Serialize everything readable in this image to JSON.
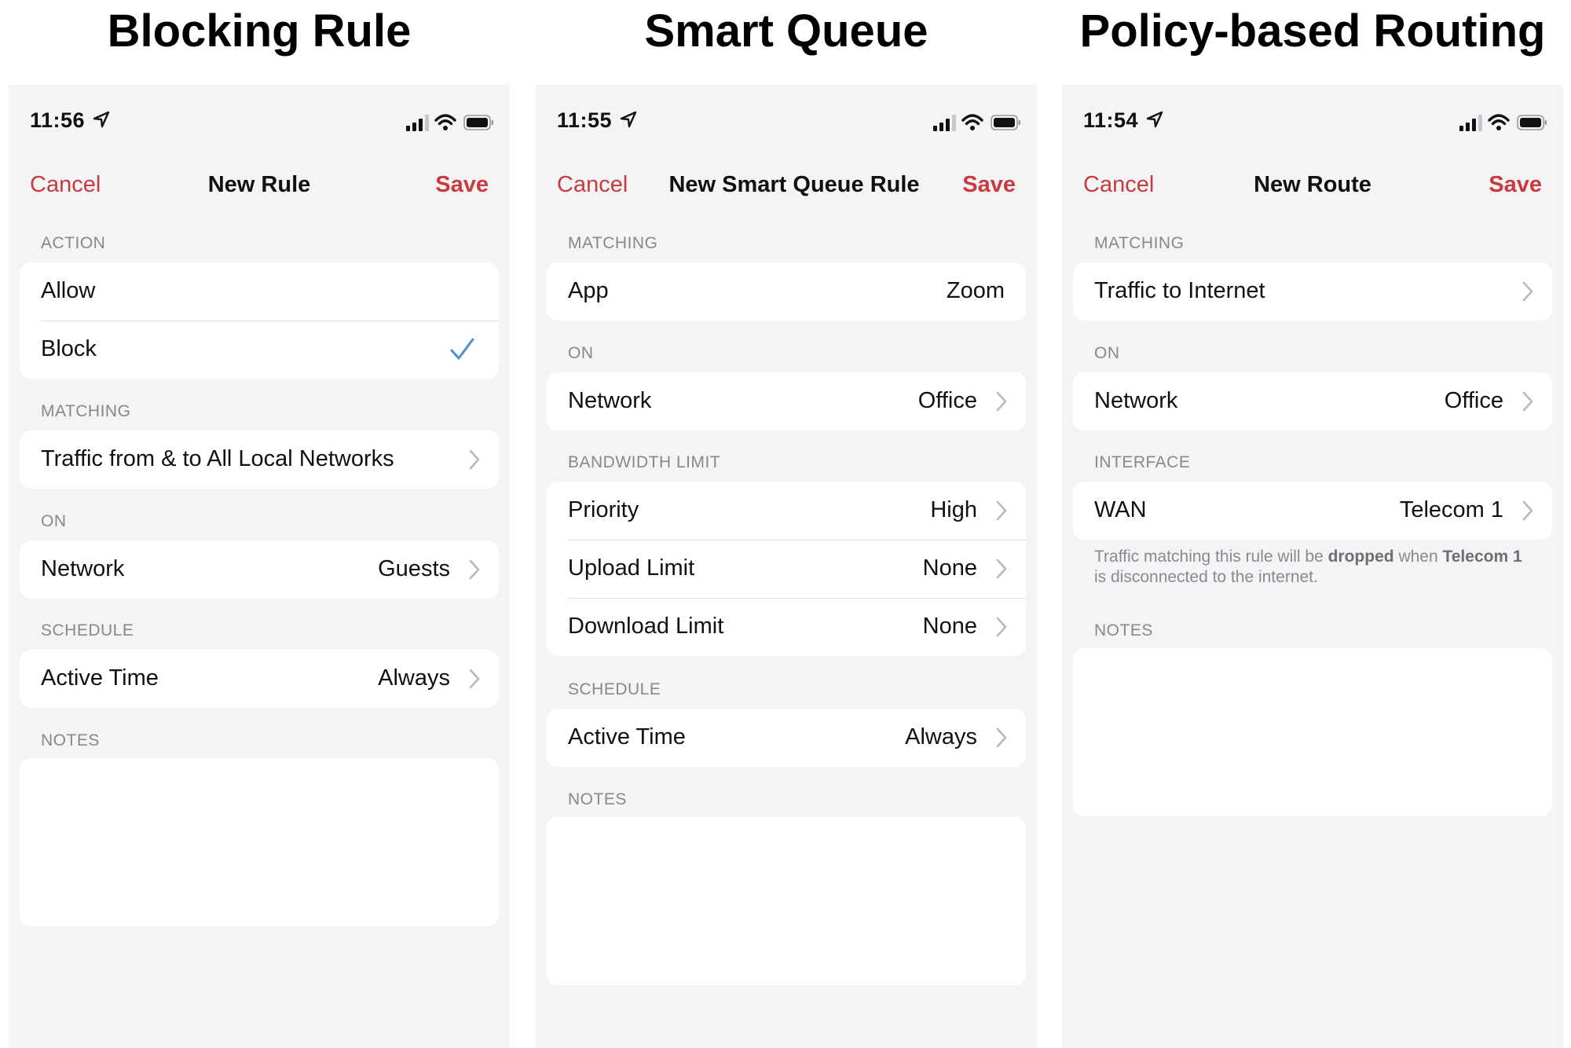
{
  "panels": [
    {
      "heading": "Blocking Rule",
      "status_time": "11:56",
      "nav": {
        "cancel": "Cancel",
        "title": "New Rule",
        "save": "Save"
      },
      "action_header": "ACTION",
      "action_options": [
        "Allow",
        "Block"
      ],
      "action_selected": "Block",
      "matching_header": "MATCHING",
      "matching_value": "Traffic from & to All Local Networks",
      "on_header": "ON",
      "network_label": "Network",
      "network_value": "Guests",
      "schedule_header": "SCHEDULE",
      "active_time_label": "Active Time",
      "active_time_value": "Always",
      "notes_header": "NOTES"
    },
    {
      "heading": "Smart Queue",
      "status_time": "11:55",
      "nav": {
        "cancel": "Cancel",
        "title": "New Smart Queue Rule",
        "save": "Save"
      },
      "matching_header": "MATCHING",
      "app_label": "App",
      "app_value": "Zoom",
      "on_header": "ON",
      "network_label": "Network",
      "network_value": "Office",
      "bandwidth_header": "BANDWIDTH LIMIT",
      "priority_label": "Priority",
      "priority_value": "High",
      "upload_label": "Upload Limit",
      "upload_value": "None",
      "download_label": "Download Limit",
      "download_value": "None",
      "schedule_header": "SCHEDULE",
      "active_time_label": "Active Time",
      "active_time_value": "Always",
      "notes_header": "NOTES"
    },
    {
      "heading": "Policy-based Routing",
      "status_time": "11:54",
      "nav": {
        "cancel": "Cancel",
        "title": "New Route",
        "save": "Save"
      },
      "matching_header": "MATCHING",
      "matching_value": "Traffic to Internet",
      "on_header": "ON",
      "network_label": "Network",
      "network_value": "Office",
      "interface_header": "INTERFACE",
      "wan_label": "WAN",
      "wan_value": "Telecom 1",
      "footnote": {
        "part1": "Traffic matching this rule will be ",
        "bold1": "dropped",
        "part2": " when ",
        "bold2": "Telecom 1",
        "part3": " is disconnected to the internet."
      },
      "notes_header": "NOTES"
    }
  ],
  "colors": {
    "accent": "#c93a3e",
    "check": "#4a8fd8",
    "background": "#f4f4f6"
  },
  "icons": [
    "location-arrow-icon",
    "signal-icon",
    "wifi-icon",
    "battery-icon",
    "chevron-right-icon",
    "checkmark-icon"
  ]
}
